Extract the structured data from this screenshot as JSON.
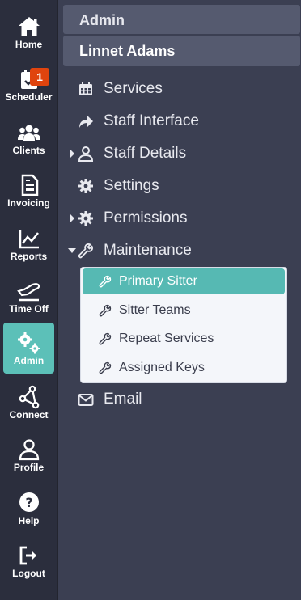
{
  "rail": {
    "items": [
      {
        "label": "Home",
        "icon": "home-icon"
      },
      {
        "label": "Scheduler",
        "icon": "calendar-check-icon",
        "badge": "1"
      },
      {
        "label": "Clients",
        "icon": "users-icon"
      },
      {
        "label": "Invoicing",
        "icon": "invoice-icon"
      },
      {
        "label": "Reports",
        "icon": "line-chart-icon"
      },
      {
        "label": "Time Off",
        "icon": "plane-icon"
      },
      {
        "label": "Admin",
        "icon": "cogs-icon",
        "active": true
      },
      {
        "label": "Connect",
        "icon": "share-nodes-icon"
      },
      {
        "label": "Profile",
        "icon": "user-icon"
      },
      {
        "label": "Help",
        "icon": "question-circle-icon"
      },
      {
        "label": "Logout",
        "icon": "logout-icon"
      }
    ]
  },
  "panel": {
    "section_title": "Admin",
    "user_name": "Linnet Adams",
    "menu": [
      {
        "label": "Services",
        "icon": "calendar-grid-icon"
      },
      {
        "label": "Staff Interface",
        "icon": "share-arrow-icon"
      },
      {
        "label": "Staff Details",
        "icon": "user-outline-icon",
        "expandable": true,
        "expanded": false
      },
      {
        "label": "Settings",
        "icon": "gear-icon"
      },
      {
        "label": "Permissions",
        "icon": "gear-icon",
        "expandable": true,
        "expanded": false
      },
      {
        "label": "Maintenance",
        "icon": "wrench-icon",
        "expandable": true,
        "expanded": true
      },
      {
        "label": "Email",
        "icon": "envelope-icon"
      }
    ],
    "maintenance_items": [
      {
        "label": "Primary Sitter",
        "icon": "wrench-icon",
        "active": true
      },
      {
        "label": "Sitter Teams",
        "icon": "wrench-icon"
      },
      {
        "label": "Repeat Services",
        "icon": "wrench-icon"
      },
      {
        "label": "Assigned Keys",
        "icon": "wrench-icon"
      }
    ]
  },
  "colors": {
    "rail_bg": "#2b2e3d",
    "panel_bg": "#3b3f52",
    "header_bg": "#555a6f",
    "accent": "#5cc0b8",
    "badge": "#e0440e"
  }
}
